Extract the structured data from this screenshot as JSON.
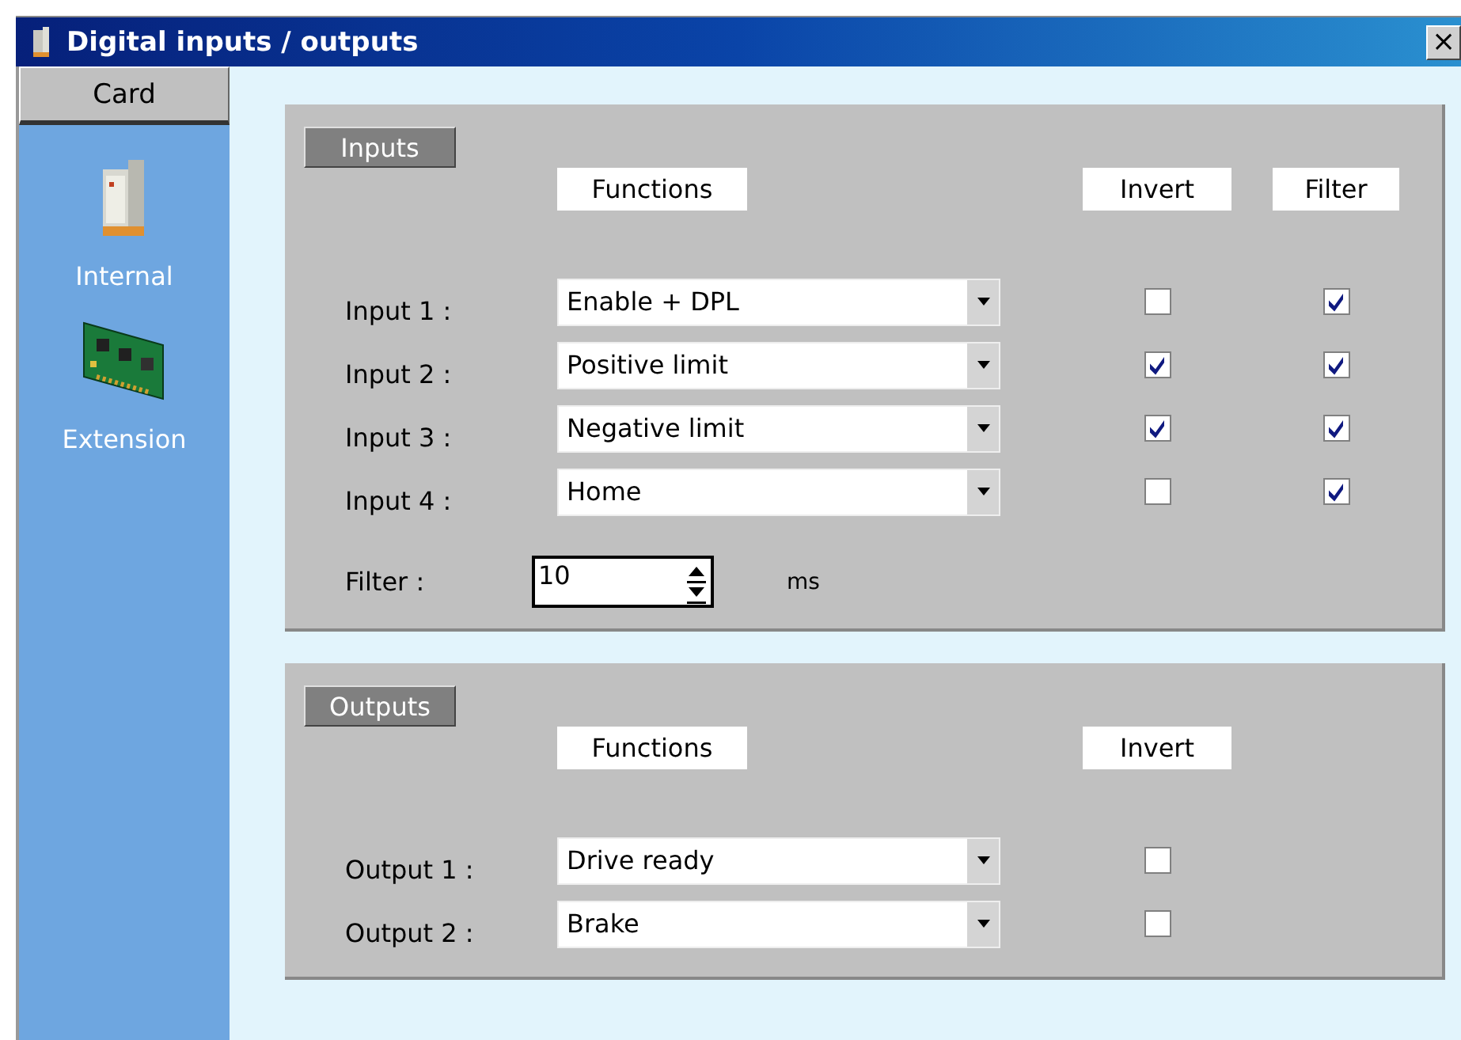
{
  "window": {
    "title": "Digital inputs / outputs",
    "close": "×"
  },
  "sidebar": {
    "header": "Card",
    "items": [
      {
        "label": "Internal",
        "kind": "module"
      },
      {
        "label": "Extension",
        "kind": "board"
      }
    ]
  },
  "inputs": {
    "group": "Inputs",
    "columns": [
      "Functions",
      "Invert",
      "Filter"
    ],
    "rows": [
      {
        "label": "Input 1 :",
        "function": "Enable + DPL",
        "invert": false,
        "filter": true
      },
      {
        "label": "Input 2 :",
        "function": "Positive limit",
        "invert": true,
        "filter": true
      },
      {
        "label": "Input 3 :",
        "function": "Negative limit",
        "invert": true,
        "filter": true
      },
      {
        "label": "Input 4 :",
        "function": "Home",
        "invert": false,
        "filter": true
      }
    ],
    "filter": {
      "label": "Filter :",
      "value": "10",
      "unit": "ms"
    }
  },
  "outputs": {
    "group": "Outputs",
    "columns": [
      "Functions",
      "Invert"
    ],
    "rows": [
      {
        "label": "Output 1 :",
        "function": "Drive ready",
        "invert": false
      },
      {
        "label": "Output 2 :",
        "function": "Brake",
        "invert": false
      }
    ]
  }
}
